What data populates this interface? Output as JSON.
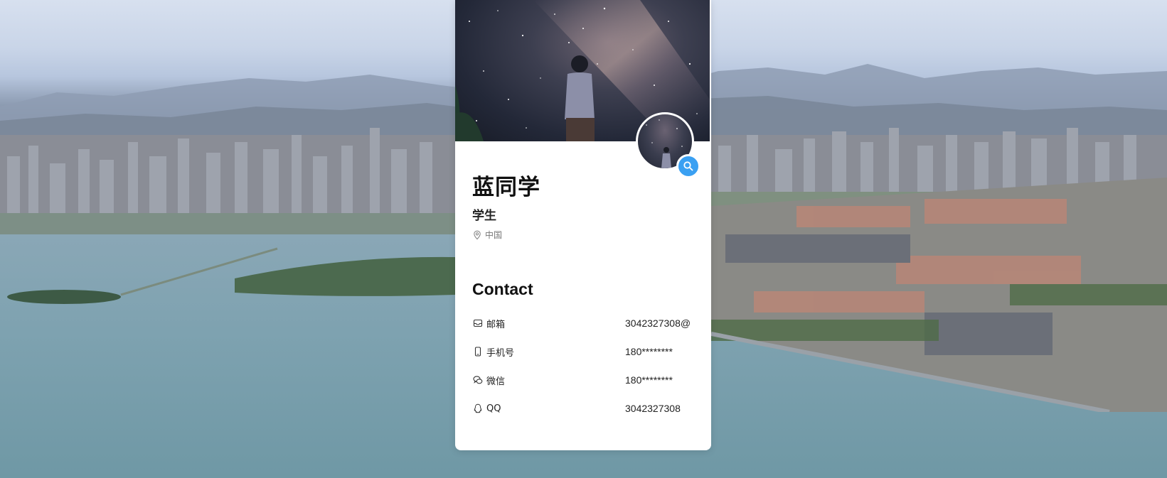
{
  "profile": {
    "name": "蓝同学",
    "title": "学生",
    "location": "中国"
  },
  "contact": {
    "heading": "Contact",
    "items": [
      {
        "icon": "mail-icon",
        "label": "邮箱",
        "value": "3042327308@"
      },
      {
        "icon": "phone-icon",
        "label": "手机号",
        "value": "180********"
      },
      {
        "icon": "wechat-icon",
        "label": "微信",
        "value": "180********"
      },
      {
        "icon": "qq-icon",
        "label": "QQ",
        "value": "3042327308"
      }
    ]
  },
  "colors": {
    "accent": "#3aa0f2",
    "card_bg": "#ffffff",
    "text_primary": "#111111",
    "text_muted": "#777777"
  }
}
